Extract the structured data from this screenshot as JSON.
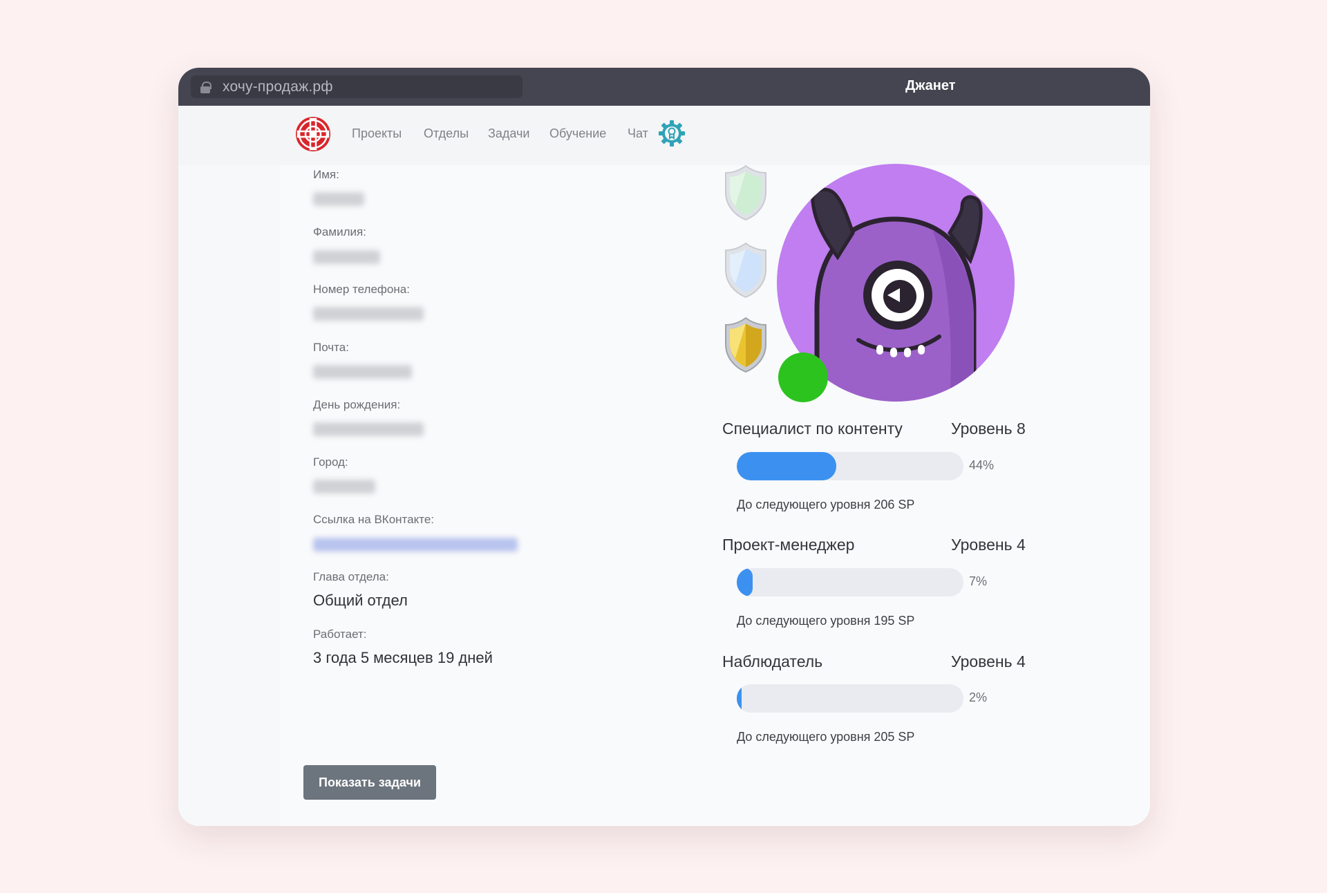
{
  "browser": {
    "url": "хочу-продаж.рф",
    "title": "Джанет"
  },
  "nav": {
    "items": [
      "Проекты",
      "Отделы",
      "Задачи",
      "Обучение",
      "Чат"
    ]
  },
  "profile": {
    "fields": [
      {
        "label": "Имя:"
      },
      {
        "label": "Фамилия:"
      },
      {
        "label": "Номер телефона:"
      },
      {
        "label": "Почта:"
      },
      {
        "label": "День рождения:"
      },
      {
        "label": "Город:"
      },
      {
        "label": "Ссылка на ВКонтакте:"
      }
    ],
    "department_head_label": "Глава отдела:",
    "department_head_value": "Общий отдел",
    "works_label": "Работает:",
    "works_value": "3 года 5 месяцев 19 дней",
    "show_tasks_button": "Показать задачи"
  },
  "skills": [
    {
      "name": "Специалист по контенту",
      "level": "Уровень 8",
      "percent_label": "44%",
      "progress": 0.44,
      "next": "До следующего уровня 206 SP"
    },
    {
      "name": "Проект-менеджер",
      "level": "Уровень 4",
      "percent_label": "7%",
      "progress": 0.07,
      "next": "До следующего уровня 195 SP"
    },
    {
      "name": "Наблюдатель",
      "level": "Уровень 4",
      "percent_label": "2%",
      "progress": 0.02,
      "next": "До следующего уровня 205 SP"
    }
  ],
  "badges": [
    {
      "icon": "green-shield-icon",
      "color": "#cdeed2"
    },
    {
      "icon": "blue-shield-icon",
      "color": "#cfe2fb"
    },
    {
      "icon": "gold-shield-icon",
      "color": "#e9c430"
    }
  ],
  "colors": {
    "accent": "#3c91f0",
    "online": "#2cc31f",
    "avatar_bg": "#c07ef0",
    "logo": "#d8262c",
    "gear": "#2ea3b8"
  }
}
